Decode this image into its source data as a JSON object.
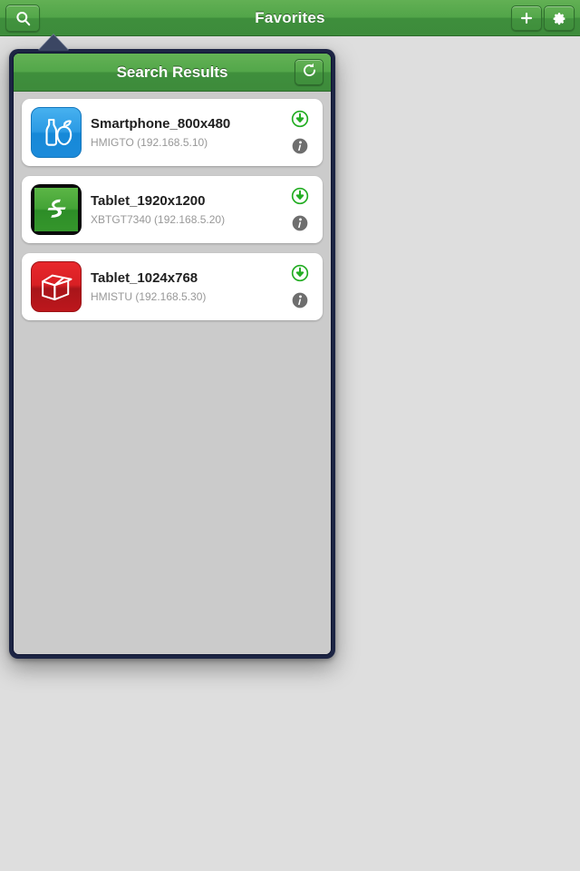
{
  "navbar": {
    "title": "Favorites",
    "search_button": {
      "name": "search",
      "icon": "search-icon"
    },
    "add_button": {
      "name": "add",
      "icon": "plus-icon"
    },
    "settings_button": {
      "name": "settings",
      "icon": "gear-icon"
    }
  },
  "popover": {
    "title": "Search Results",
    "refresh_button": {
      "icon": "refresh-icon"
    },
    "items": [
      {
        "title": "Smartphone_800x480",
        "subtitle": "HMIGTO (192.168.5.10)",
        "icon": "bottle-fruit-icon",
        "icon_style": "blue",
        "download_icon": "download-icon",
        "info_icon": "info-icon"
      },
      {
        "title": "Tablet_1920x1200",
        "subtitle": "XBTGT7340 (192.168.5.20)",
        "icon": "schneider-logo-icon",
        "icon_style": "green",
        "download_icon": "download-icon",
        "info_icon": "info-icon"
      },
      {
        "title": "Tablet_1024x768",
        "subtitle": "HMISTU (192.168.5.30)",
        "icon": "open-box-icon",
        "icon_style": "red",
        "download_icon": "download-icon",
        "info_icon": "info-icon"
      }
    ]
  },
  "colors": {
    "nav_green": "#52a549",
    "nav_green_dark": "#3d8c3b",
    "popover_border": "#1d2544",
    "list_background": "#cbcbcb",
    "page_background": "#dedede",
    "download_green": "#2cb42c",
    "info_gray": "#6e6e6e",
    "icon_blue": "#2b9ae4",
    "icon_green": "#43a336",
    "icon_red": "#d81f24"
  }
}
